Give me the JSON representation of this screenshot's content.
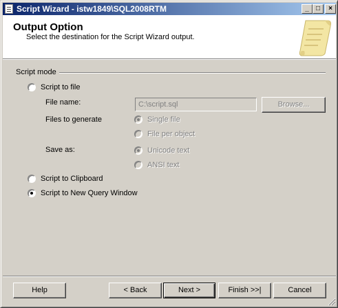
{
  "window": {
    "title": "Script Wizard - istw1849\\SQL2008RTM",
    "controls": {
      "minimize": "_",
      "maximize": "□",
      "close": "×"
    }
  },
  "header": {
    "title": "Output Option",
    "subtitle": "Select the destination for the Script Wizard output.",
    "art_icon": "scroll-icon"
  },
  "script_mode": {
    "group_label": "Script mode",
    "to_file": {
      "label": "Script to file",
      "selected": false,
      "file_name_label": "File name:",
      "file_name_value": "C:\\script.sql",
      "browse_label": "Browse...",
      "files_to_generate_label": "Files to generate",
      "single_file_label": "Single file",
      "file_per_object_label": "File per object",
      "save_as_label": "Save as:",
      "unicode_label": "Unicode text",
      "ansi_label": "ANSI text"
    },
    "to_clipboard": {
      "label": "Script to Clipboard",
      "selected": false
    },
    "to_query_window": {
      "label": "Script to New Query Window",
      "selected": true
    }
  },
  "buttons": {
    "help": "Help",
    "back": "< Back",
    "next": "Next >",
    "finish": "Finish >>|",
    "cancel": "Cancel"
  }
}
